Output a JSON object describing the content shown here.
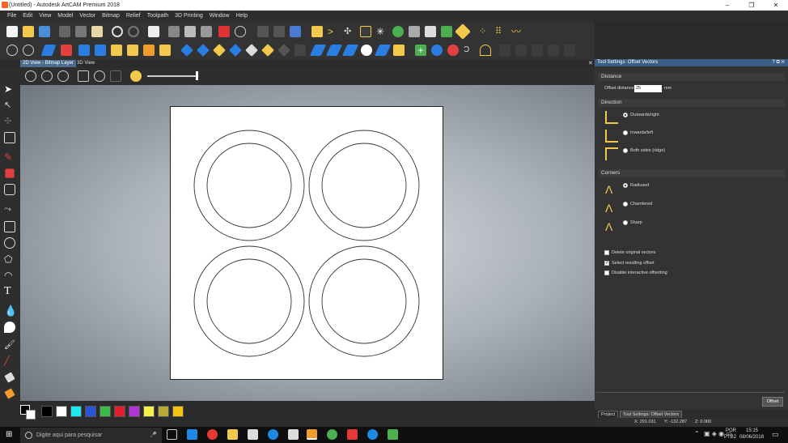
{
  "window": {
    "title": "(Untitled) - Autodesk ArtCAM Premium 2018",
    "minimize": "–",
    "maximize": "❐",
    "close": "✕"
  },
  "menu": [
    "File",
    "Edit",
    "View",
    "Model",
    "Vector",
    "Bitmap",
    "Relief",
    "Toolpath",
    "3D Printing",
    "Window",
    "Help"
  ],
  "tabs": {
    "active": "2D View - Bitmap Layer",
    "other": "3D View"
  },
  "palette": {
    "colors": [
      "#000000",
      "#ffffff",
      "#1ee8f0",
      "#2a55d8",
      "#3cba4a",
      "#e01f2a",
      "#b233d6",
      "#f4ee4a",
      "#b8a93a",
      "#f2c414"
    ]
  },
  "panel": {
    "title": "Tool Settings: Offset Vectors",
    "title_icons": "? ⧉ ✕",
    "distance": {
      "heading": "Distance",
      "label": "Offset distance",
      "value": "25",
      "unit": "mm"
    },
    "direction": {
      "heading": "Direction",
      "options": [
        "Outwards/right",
        "Inwards/left",
        "Both sides (ridge)"
      ],
      "selected": "Outwards/right"
    },
    "corners": {
      "heading": "Corners",
      "options": [
        "Radiused",
        "Chamfered",
        "Sharp"
      ],
      "selected": "Radiused"
    },
    "checks": [
      {
        "label": "Delete original vectors",
        "checked": false
      },
      {
        "label": "Select resulting offset",
        "checked": true
      },
      {
        "label": "Disable interactive offsetting",
        "checked": false
      }
    ],
    "button": "Offset",
    "tabs": [
      "Project",
      "Tool Settings: Offset Vectors"
    ]
  },
  "status": {
    "x": "X: 291.031",
    "y": "Y: -132.287",
    "z": "Z: 0.000"
  },
  "taskbar": {
    "search_placeholder": "Digite aqui para pesquisar",
    "lang1": "POR",
    "lang2": "PTB2",
    "time": "15:15",
    "date": "08/06/2018"
  }
}
